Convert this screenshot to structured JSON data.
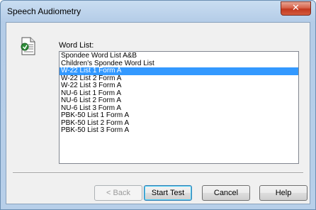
{
  "window": {
    "title": "Speech Audiometry",
    "close_glyph": "✕"
  },
  "icons": {
    "document": "document-icon",
    "close": "close-icon"
  },
  "word_list": {
    "label": "Word List:",
    "selected_index": 2,
    "items": [
      "Spondee Word List A&B",
      "Children's Spondee Word List",
      "W-22 List 1 Form A",
      "W-22 List 2 Form A",
      "W-22 List 3 Form A",
      "NU-6 List 1 Form A",
      "NU-6 List 2 Form A",
      "NU-6 List 3 Form A",
      "PBK-50 List 1 Form A",
      "PBK-50 List 2 Form A",
      "PBK-50 List 3 Form A"
    ]
  },
  "buttons": {
    "back": "< Back",
    "start_test": "Start Test",
    "cancel": "Cancel",
    "help": "Help"
  },
  "colors": {
    "selection": "#3399ff",
    "close_button": "#c2381e"
  }
}
